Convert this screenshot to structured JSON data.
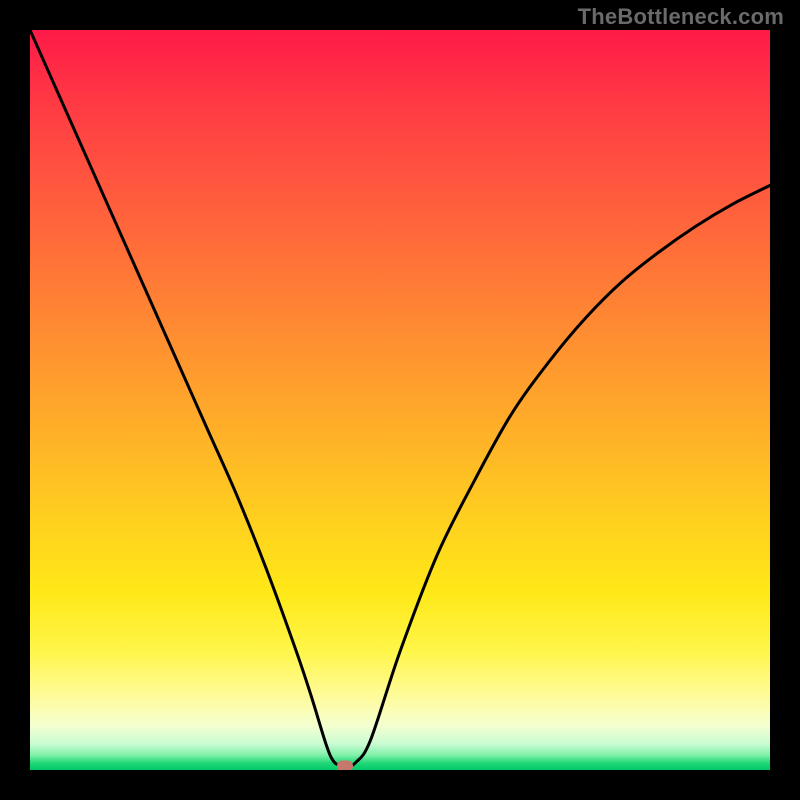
{
  "watermark": "TheBottleneck.com",
  "colors": {
    "frame": "#000000",
    "curve": "#000000",
    "marker": "#c6786d",
    "gradient_stops": [
      "#ff1a48",
      "#ff3a44",
      "#ff5a3e",
      "#ff7a36",
      "#ff9a2e",
      "#ffb726",
      "#ffd21e",
      "#ffe818",
      "#fff64a",
      "#fffb9a",
      "#f4ffd0",
      "#c9fcd2",
      "#7ef0a8",
      "#25d878",
      "#00c96a"
    ]
  },
  "chart_data": {
    "type": "line",
    "title": "",
    "xlabel": "",
    "ylabel": "",
    "xlim": [
      0,
      100
    ],
    "ylim": [
      0,
      100
    ],
    "grid": false,
    "legend": false,
    "series": [
      {
        "name": "bottleneck-curve",
        "x": [
          0,
          4,
          8,
          12,
          16,
          20,
          24,
          28,
          32,
          36,
          38,
          40,
          41,
          42,
          43,
          44,
          46,
          50,
          55,
          60,
          65,
          70,
          75,
          80,
          85,
          90,
          95,
          100
        ],
        "y": [
          100,
          91,
          82,
          73,
          64,
          55,
          46,
          37,
          27,
          16,
          10,
          3.5,
          1.2,
          0.6,
          0.6,
          1.0,
          4,
          16,
          29,
          39,
          48,
          55,
          61,
          66,
          70,
          73.5,
          76.5,
          79
        ]
      }
    ],
    "optimal_point": {
      "x": 42.5,
      "y": 0.6
    },
    "flat_bottom_x_range": [
      40.8,
      43.6
    ]
  }
}
